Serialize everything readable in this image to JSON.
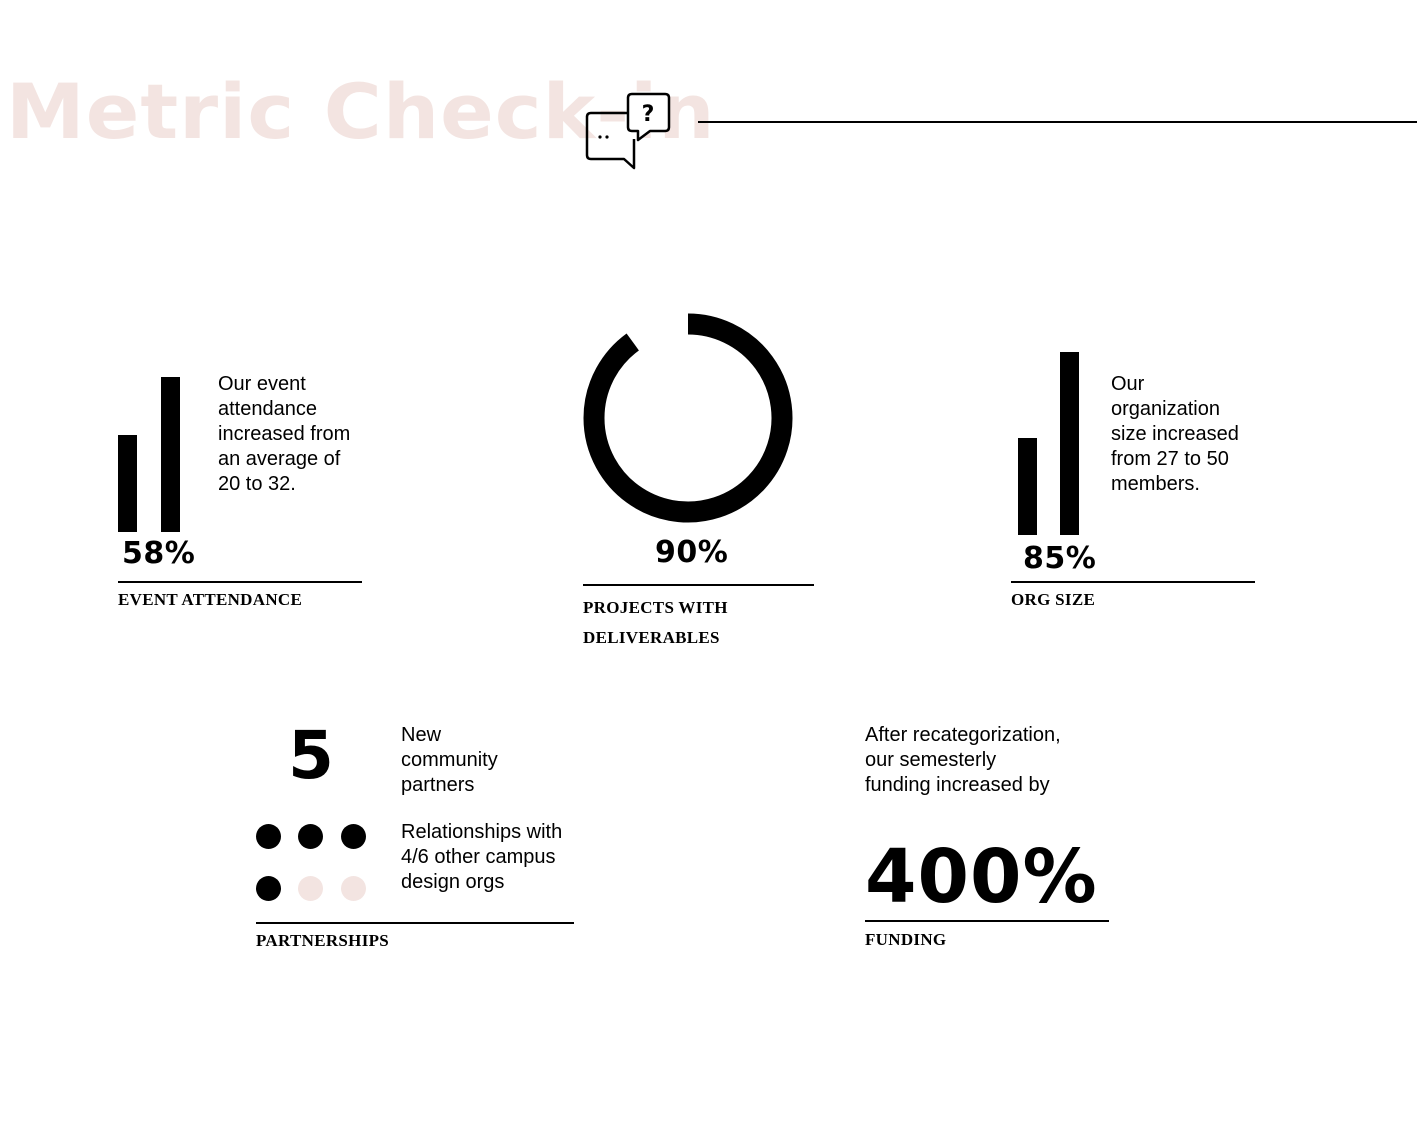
{
  "header": {
    "title": "Metric Check-in",
    "icon": "chat-question-icon",
    "title_color": "#f3e4e1"
  },
  "event_attendance": {
    "percent": "58%",
    "description": "Our event attendance increased from an average of 20 to 32.",
    "caption": "EVENT ATTENDANCE",
    "bars": [
      20,
      32
    ]
  },
  "projects": {
    "percent": "90%",
    "progress": 0.9,
    "caption_line1": "PROJECTS WITH",
    "caption_line2": "DELIVERABLES"
  },
  "org_size": {
    "percent": "85%",
    "description": "Our organization size increased from 27 to 50 members.",
    "caption": "ORG SIZE",
    "bars": [
      27,
      50
    ]
  },
  "partnerships": {
    "count": "5",
    "count_label": "New community partners",
    "relationships": "Relationships with 4/6 other campus design orgs",
    "dots_filled": 4,
    "dots_total": 6,
    "caption": "PARTNERSHIPS"
  },
  "funding": {
    "description": "After recategorization, our semesterly funding increased by",
    "percent": "400%",
    "caption": "FUNDING"
  },
  "colors": {
    "ink": "#000000",
    "accent_pink": "#f3e4e1"
  }
}
